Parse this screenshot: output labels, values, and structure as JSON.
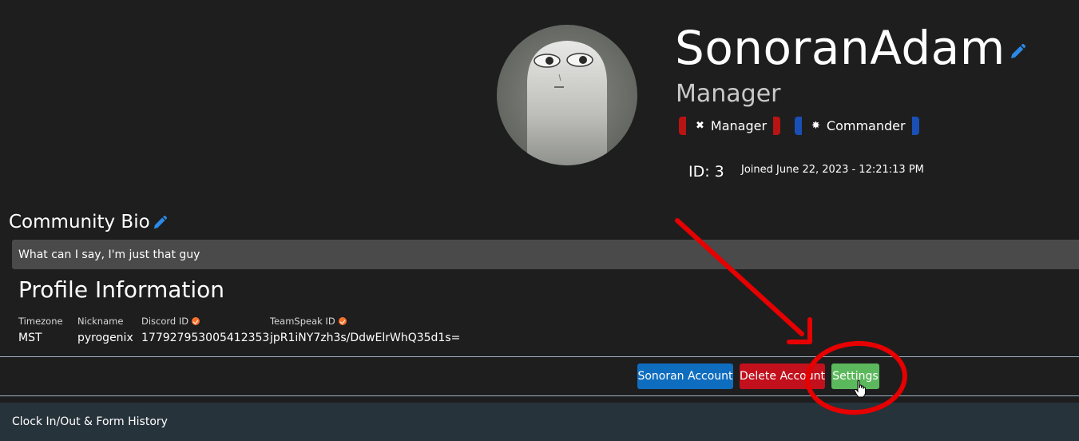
{
  "profile": {
    "username": "SonoranAdam",
    "role_title": "Manager",
    "badges": [
      {
        "label": "Manager",
        "icon": "crosshair-icon",
        "color": "#b81414"
      },
      {
        "label": "Commander",
        "icon": "star-emblem-icon",
        "color": "#1a4fb5"
      }
    ],
    "id_text": "ID: 3",
    "joined_text": "Joined June 22, 2023 - 12:21:13 PM"
  },
  "bio": {
    "heading": "Community Bio",
    "text": "What can I say, I'm just that guy"
  },
  "profile_info": {
    "heading": "Profile Information",
    "fields": [
      {
        "label": "Timezone",
        "value": "MST",
        "verified": false
      },
      {
        "label": "Nickname",
        "value": "pyrogenix",
        "verified": false
      },
      {
        "label": "Discord ID",
        "value": "177927953005412353",
        "verified": true
      },
      {
        "label": "TeamSpeak ID",
        "value": "jpR1iNY7zh3s/DdwElrWhQ35d1s=",
        "verified": true
      }
    ]
  },
  "actions": {
    "sonoran_account": "Sonoran Account",
    "delete_account": "Delete Account",
    "settings": "Settings"
  },
  "footer": {
    "label": "Clock In/Out & Form History"
  },
  "colors": {
    "background": "#1e1e1f",
    "primary_button": "#0f6dbf",
    "danger_button": "#c2101c",
    "success_button": "#5cb85c",
    "edit_icon": "#2b8ae6",
    "verified_badge": "#f5712a",
    "annotation": "#e60000"
  }
}
